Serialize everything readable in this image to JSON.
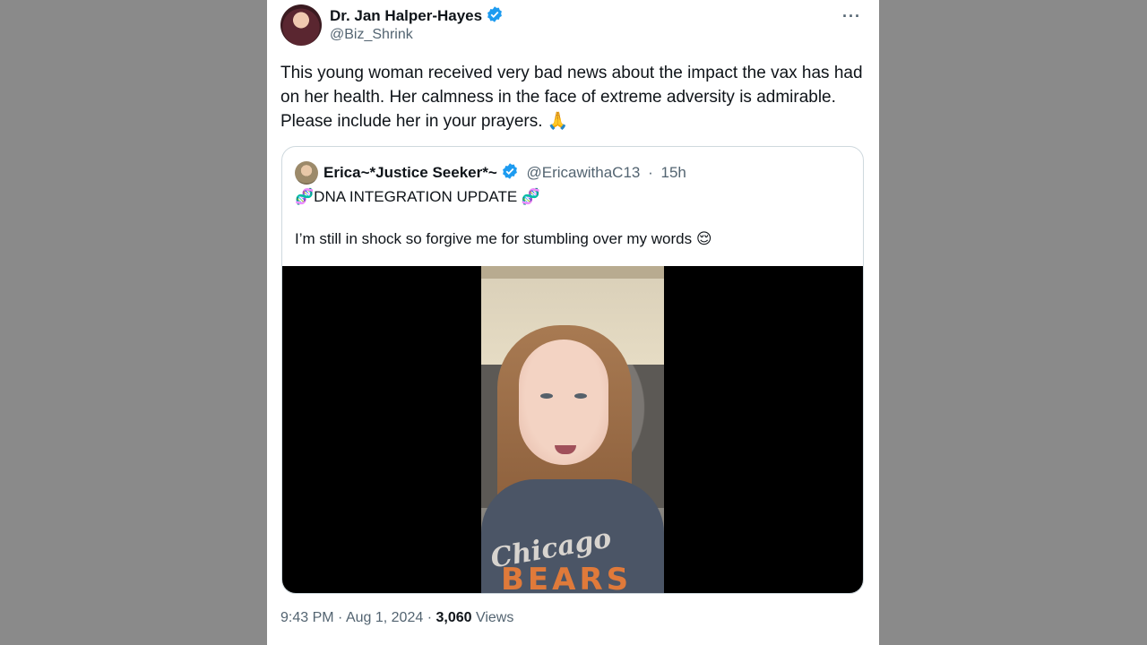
{
  "tweet": {
    "author_name": "Dr. Jan Halper-Hayes",
    "author_handle": "@Biz_Shrink",
    "more_label": "···",
    "text": "This young woman received very bad news about the impact the vax has had on her health. Her calmness in the face of extreme adversity is admirable. Please include her in your prayers.",
    "text_emoji": "🙏",
    "time": "9:43 PM",
    "date": "Aug 1, 2024",
    "views_count": "3,060",
    "views_label": "Views"
  },
  "quote": {
    "author_name": "Erica~*Justice Seeker*~",
    "author_handle": "@EricawithaC13",
    "age": "15h",
    "line1_emoji": "🧬",
    "line1": "DNA INTEGRATION UPDATE",
    "line2": "I’m still in shock so forgive me for stumbling over my words",
    "line2_emoji": "😌"
  },
  "video": {
    "shirt_text_1": "Chicago",
    "shirt_text_2": "BEARS"
  },
  "colors": {
    "verified": "#1d9bf0",
    "secondary_text": "#536471",
    "primary_text": "#0f1419"
  },
  "icons": {
    "verified": "verified-badge-icon",
    "more": "more-options-icon"
  }
}
